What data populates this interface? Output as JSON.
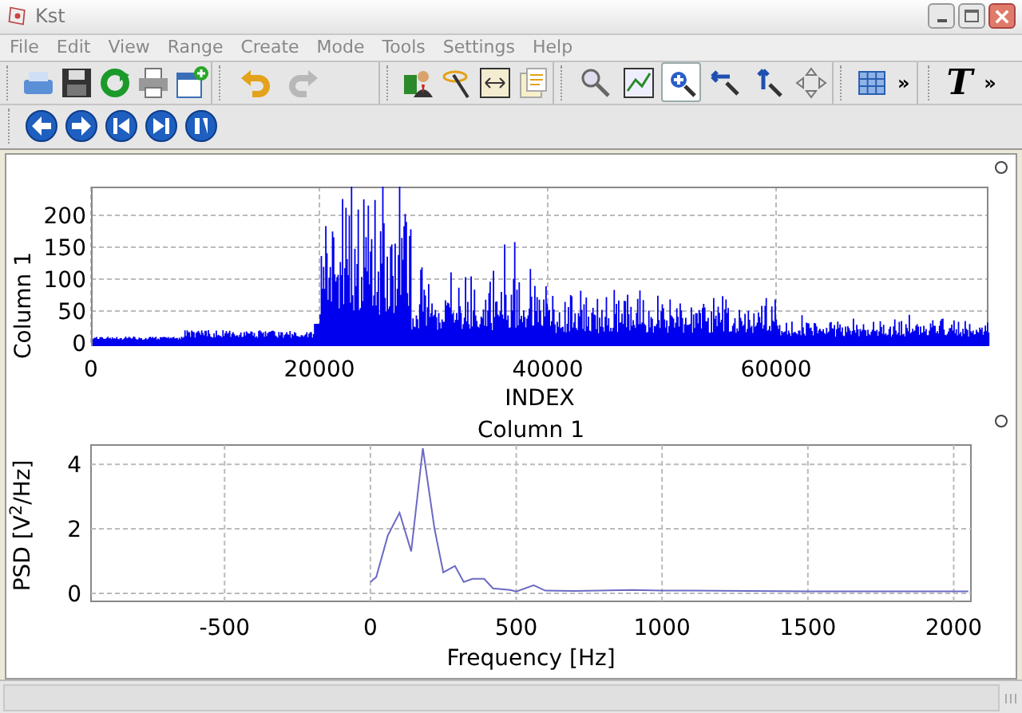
{
  "window": {
    "title": "Kst"
  },
  "menu": [
    {
      "label": "File"
    },
    {
      "label": "Edit"
    },
    {
      "label": "View"
    },
    {
      "label": "Range"
    },
    {
      "label": "Create"
    },
    {
      "label": "Mode"
    },
    {
      "label": "Tools"
    },
    {
      "label": "Settings"
    },
    {
      "label": "Help"
    }
  ],
  "edit_tools": [
    {
      "disabled": false
    },
    {
      "disabled": true
    }
  ],
  "mode_tools": [
    {
      "selected": false
    },
    {
      "selected": false
    },
    {
      "selected": true
    },
    {
      "selected": false
    },
    {
      "selected": false
    },
    {
      "selected": false
    }
  ],
  "layout_overflow": "»",
  "text_tool": {
    "label": "T",
    "overflow": "»"
  },
  "signal_plot": {
    "ylabel": "Column 1",
    "xlabel": "INDEX",
    "xticks": [
      "0",
      "20000",
      "40000",
      "60000"
    ],
    "yticks": [
      "200",
      "150",
      "100",
      "50",
      "0"
    ]
  },
  "psd_plot": {
    "chart_data": {
      "type": "line",
      "title": "Column 1",
      "xlabel": "Frequency [Hz]",
      "ylabel": "PSD [V$^{2}$/Hz]",
      "x": [
        0,
        20,
        60,
        100,
        140,
        180,
        220,
        250,
        290,
        320,
        350,
        390,
        420,
        480,
        500,
        560,
        600,
        700,
        900,
        1000,
        1100,
        1500,
        2000,
        2050
      ],
      "series": [
        {
          "color": "#6b6bc4",
          "values": [
            0.35,
            0.5,
            1.8,
            2.5,
            1.3,
            4.5,
            2.0,
            0.65,
            0.85,
            0.35,
            0.45,
            0.45,
            0.15,
            0.1,
            0.05,
            0.25,
            0.08,
            0.07,
            0.1,
            0.08,
            0.08,
            0.06,
            0.06,
            0.06
          ]
        }
      ],
      "xlim": [
        -958,
        2059
      ],
      "ylim": [
        -0.25,
        4.6
      ],
      "xticks": [
        -500,
        0,
        500,
        1000,
        1500,
        2000
      ],
      "yticks": [
        4,
        2,
        0
      ],
      "grid": true
    }
  }
}
